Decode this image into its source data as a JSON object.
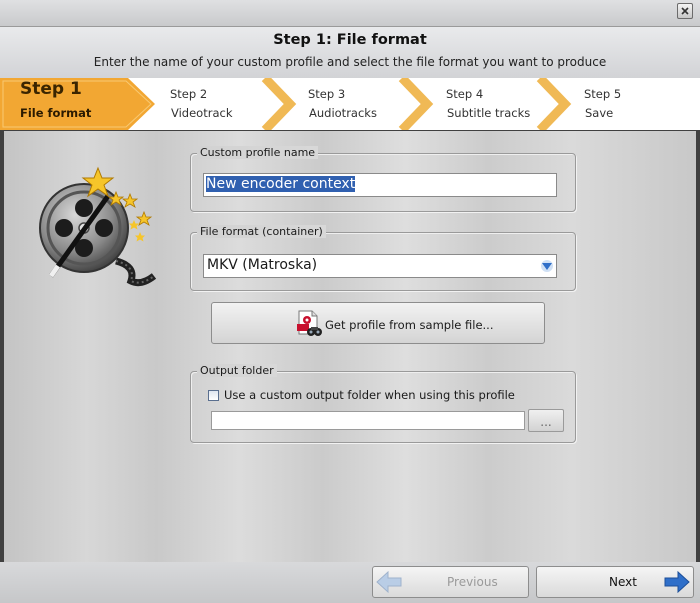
{
  "window": {
    "close_icon": "close-x-icon"
  },
  "header": {
    "title": "Step 1: File format",
    "subtitle": "Enter the name of your custom profile and select the file format you want to produce"
  },
  "steps": [
    {
      "num": "Step 1",
      "name": "File format",
      "active": true
    },
    {
      "num": "Step 2",
      "name": "Videotrack",
      "active": false
    },
    {
      "num": "Step 3",
      "name": "Audiotracks",
      "active": false
    },
    {
      "num": "Step 4",
      "name": "Subtitle tracks",
      "active": false
    },
    {
      "num": "Step 5",
      "name": "Save",
      "active": false
    }
  ],
  "profile": {
    "label": "Custom profile name",
    "value": "New encoder context"
  },
  "format": {
    "label": "File format (container)",
    "selected": "MKV (Matroska)"
  },
  "sample_button": {
    "label": "Get profile from sample file..."
  },
  "output": {
    "label": "Output folder",
    "checkbox_label": "Use a custom output folder when using this profile",
    "checked": false,
    "path": "",
    "browse_label": "..."
  },
  "nav": {
    "previous_label": "Previous",
    "next_label": "Next"
  },
  "colors": {
    "active_step": "#f2a733",
    "chevron": "#f0b955",
    "selection": "#3060b0",
    "arrow_blue": "#2f6fc9"
  }
}
